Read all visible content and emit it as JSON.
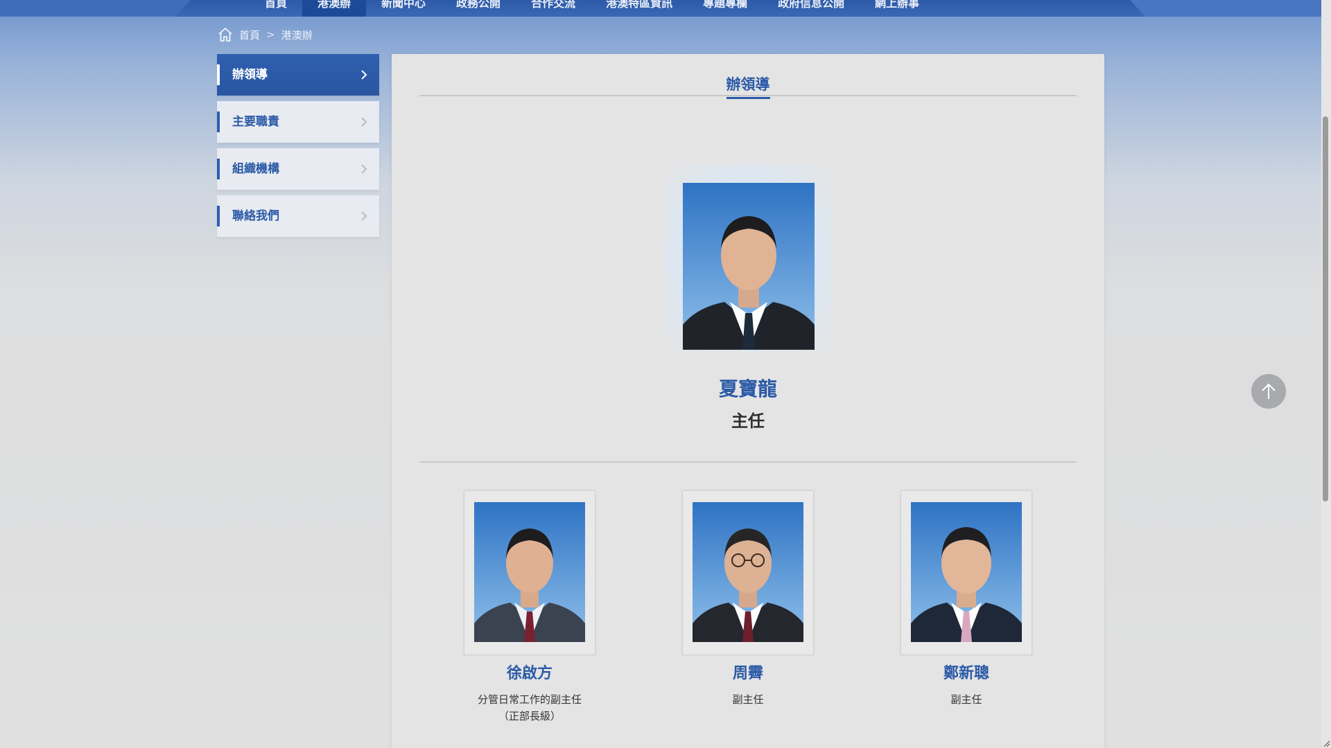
{
  "nav": {
    "items": [
      {
        "label": "首頁"
      },
      {
        "label": "港澳辦"
      },
      {
        "label": "新聞中心"
      },
      {
        "label": "政務公開"
      },
      {
        "label": "合作交流"
      },
      {
        "label": "港澳特區資訊"
      },
      {
        "label": "專題專欄"
      },
      {
        "label": "政府信息公開"
      },
      {
        "label": "網上辦事"
      }
    ],
    "active_index": 1
  },
  "breadcrumb": {
    "home": "首頁",
    "separator": ">",
    "current": "港澳辦"
  },
  "sidebar": {
    "items": [
      {
        "label": "辦領導",
        "active": true
      },
      {
        "label": "主要職責",
        "active": false
      },
      {
        "label": "組織機構",
        "active": false
      },
      {
        "label": "聯絡我們",
        "active": false
      }
    ]
  },
  "main": {
    "title": "辦領導",
    "chief": {
      "name": "夏寶龍",
      "title": "主任"
    },
    "deputies": [
      {
        "name": "徐啟方",
        "role_line1": "分管日常工作的副主任",
        "role_line2": "（正部長級）"
      },
      {
        "name": "周霽",
        "role_line1": "副主任",
        "role_line2": ""
      },
      {
        "name": "鄭新聰",
        "role_line1": "副主任",
        "role_line2": ""
      }
    ]
  },
  "icons": {
    "home": "home-icon",
    "chevron": "chevron-right-icon",
    "back_to_top": "arrow-up-icon"
  },
  "colors": {
    "brand_blue": "#2b5aa6",
    "nav_blue": "#2d5aa8",
    "page_gray": "#e0e0e0"
  }
}
